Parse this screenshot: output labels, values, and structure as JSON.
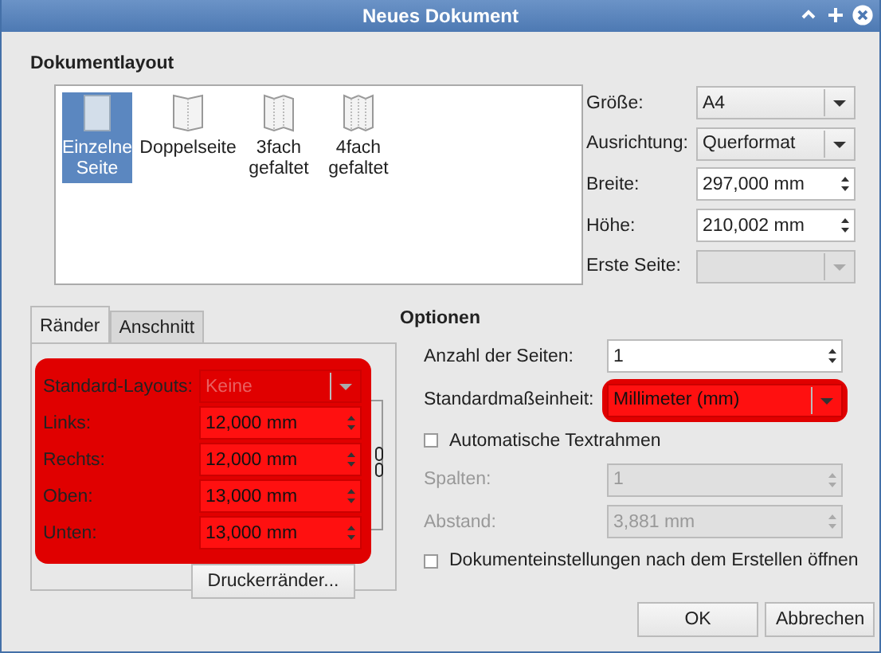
{
  "window": {
    "title": "Neues Dokument"
  },
  "layout_section": {
    "title": "Dokumentlayout",
    "layouts": [
      {
        "label": "Einzelne Seite",
        "kind": "single",
        "selected": true
      },
      {
        "label": "Doppelseite",
        "kind": "double",
        "selected": false
      },
      {
        "label": "3fach gefaltet",
        "kind": "triple",
        "selected": false
      },
      {
        "label": "4fach gefaltet",
        "kind": "quad",
        "selected": false
      }
    ],
    "fields": [
      {
        "label": "Größe:",
        "kind": "combo",
        "value": "A4",
        "disabled": false
      },
      {
        "label": "Ausrichtung:",
        "kind": "combo",
        "value": "Querformat",
        "disabled": false
      },
      {
        "label": "Breite:",
        "kind": "spin",
        "value": "297,000 mm",
        "disabled": false
      },
      {
        "label": "Höhe:",
        "kind": "spin",
        "value": "210,002 mm",
        "disabled": false
      },
      {
        "label": "Erste Seite:",
        "kind": "combo",
        "disabled": true
      }
    ]
  },
  "tabs": [
    {
      "label": "Ränder",
      "selected": true
    },
    {
      "label": "Anschnitt",
      "selected": false
    }
  ],
  "margins": {
    "highlighted": true,
    "rows": [
      {
        "label": "Standard-Layouts:",
        "kind": "combo",
        "value": "Keine",
        "disabled": true
      },
      {
        "label": "Links:",
        "kind": "spin",
        "value": "12,000 mm",
        "disabled": false
      },
      {
        "label": "Rechts:",
        "kind": "spin",
        "value": "12,000 mm",
        "disabled": false
      },
      {
        "label": "Oben:",
        "kind": "spin",
        "value": "13,000 mm",
        "disabled": false
      },
      {
        "label": "Unten:",
        "kind": "spin",
        "value": "13,000 mm",
        "disabled": false
      }
    ],
    "button": "Druckerränder..."
  },
  "options": {
    "title": "Optionen",
    "rows": [
      {
        "kind": "spin",
        "label": "Anzahl der Seiten:",
        "value": "1",
        "disabled": false,
        "highlighted": false
      },
      {
        "kind": "combo",
        "label": "Standardmaßeinheit:",
        "value": "Millimeter (mm)",
        "disabled": false,
        "highlighted": true
      },
      {
        "kind": "check",
        "label": "Automatische Textrahmen",
        "checked": false
      },
      {
        "kind": "spin",
        "label": "Spalten:",
        "value": "1",
        "disabled": true,
        "highlighted": false
      },
      {
        "kind": "spin",
        "label": "Abstand:",
        "value": "3,881 mm",
        "disabled": true,
        "highlighted": false
      },
      {
        "kind": "check",
        "label": "Dokumenteinstellungen nach dem Erstellen öffnen",
        "checked": false
      }
    ]
  },
  "buttons": [
    {
      "label": "OK"
    },
    {
      "label": "Abbrechen"
    }
  ]
}
